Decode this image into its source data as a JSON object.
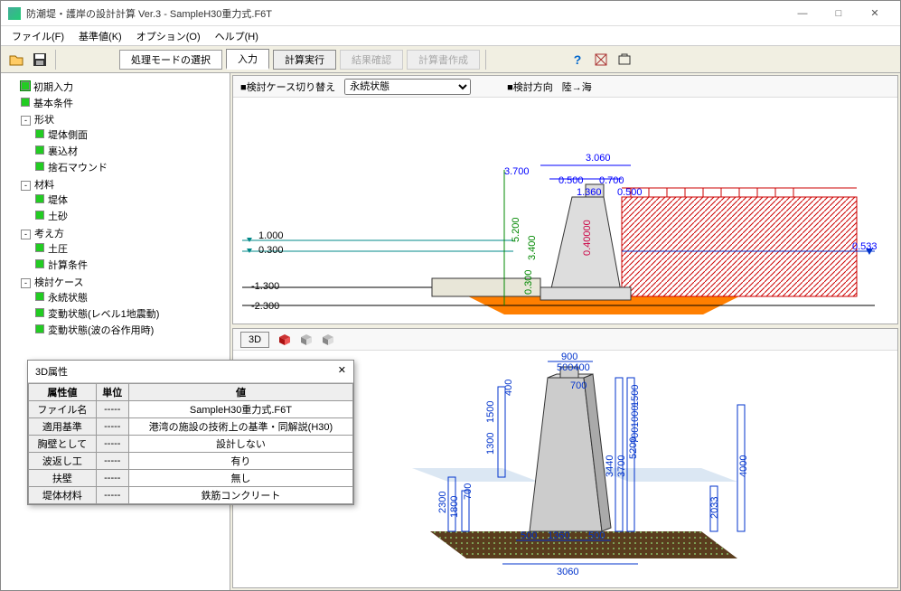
{
  "window": {
    "title": "防潮堤・護岸の設計計算 Ver.3 - SampleH30重力式.F6T",
    "min": "―",
    "max": "□",
    "close": "✕"
  },
  "menu": {
    "file": "ファイル(F)",
    "standards": "基準値(K)",
    "options": "オプション(O)",
    "help": "ヘルプ(H)"
  },
  "toolbar": {
    "mode": "処理モードの選択",
    "input": "入力",
    "run": "計算実行",
    "result": "結果確認",
    "report": "計算書作成"
  },
  "tree": {
    "n0": "初期入力",
    "n1": "基本条件",
    "n2": "形状",
    "n2_0": "堤体側面",
    "n2_1": "裏込材",
    "n2_2": "捨石マウンド",
    "n3": "材料",
    "n3_0": "堤体",
    "n3_1": "土砂",
    "n4": "考え方",
    "n4_0": "土圧",
    "n4_1": "計算条件",
    "n5": "検討ケース",
    "n5_0": "永続状態",
    "n5_1": "変動状態(レベル1地震動)",
    "n5_2": "変動状態(波の谷作用時)"
  },
  "top": {
    "label_case": "■検討ケース切り替え",
    "select_value": "永続状態",
    "label_dir": "■検討方向",
    "dir_value": "陸→海",
    "dims": {
      "d1": "3.700",
      "d2": "3.060",
      "d3": "0.500",
      "d4": "0.700",
      "d5": "1.360",
      "d6": "0.500",
      "d7": "5.200",
      "d8": "3.400",
      "d9": "0.40000",
      "d10": "0.300",
      "d11": "0.533",
      "l1": "1.000",
      "l2": "0.300",
      "l3": "-1.300",
      "l4": "-2.300"
    }
  },
  "bottom": {
    "btn3d": "3D",
    "dims": {
      "w1": "3060",
      "w2": "500",
      "w3": "1360",
      "w4": "500",
      "w5": "700",
      "w6": "900",
      "w7": "500400",
      "h1": "1500",
      "h2": "1300",
      "h3": "400",
      "h4": "3440",
      "h5": "5200",
      "h6": "3700",
      "h7": "1800",
      "h8": "2300",
      "h9": "700",
      "h10": "2033",
      "h11": "4000",
      "h12": "1500",
      "h13": "1000",
      "h14": "700"
    }
  },
  "panel": {
    "title": "3D属性",
    "close": "✕",
    "hdr_attr": "属性値",
    "hdr_unit": "単位",
    "hdr_val": "値",
    "rows": [
      {
        "a": "ファイル名",
        "u": "-----",
        "v": "SampleH30重力式.F6T"
      },
      {
        "a": "適用基準",
        "u": "-----",
        "v": "港湾の施設の技術上の基準・同解説(H30)"
      },
      {
        "a": "胸壁として",
        "u": "-----",
        "v": "設計しない"
      },
      {
        "a": "波返し工",
        "u": "-----",
        "v": "有り"
      },
      {
        "a": "扶壁",
        "u": "-----",
        "v": "無し"
      },
      {
        "a": "堤体材料",
        "u": "-----",
        "v": "鉄筋コンクリート"
      }
    ]
  }
}
